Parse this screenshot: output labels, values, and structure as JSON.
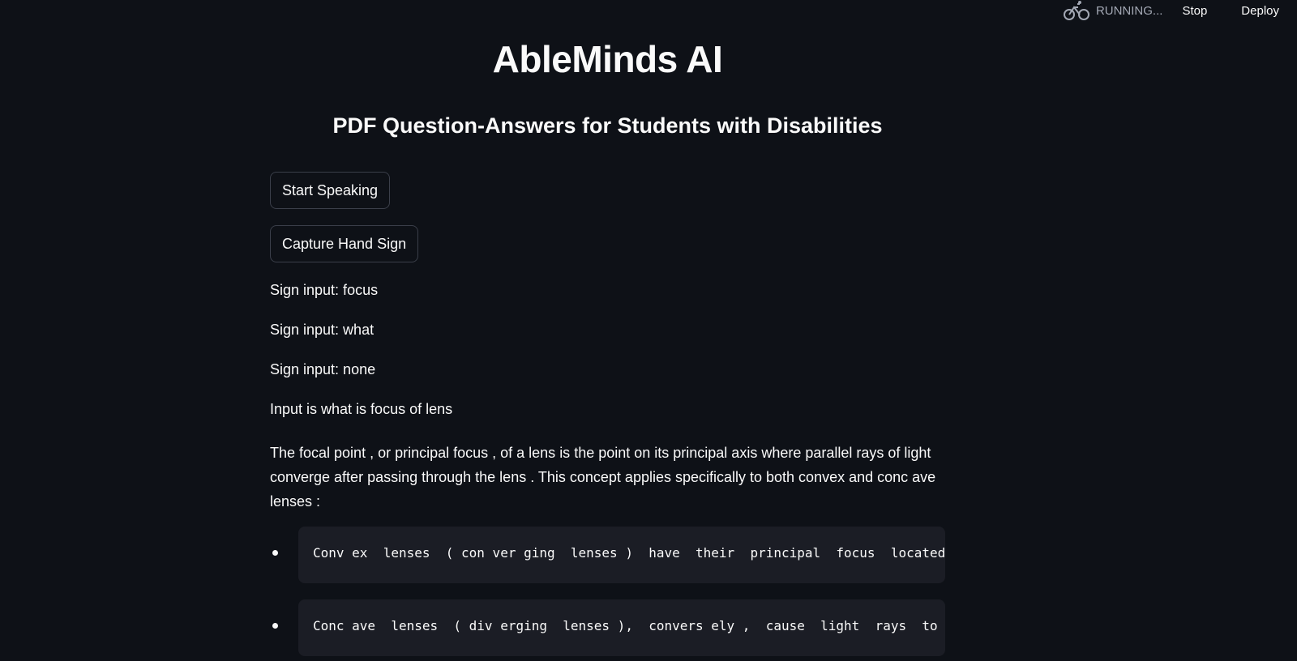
{
  "header": {
    "status_text": "RUNNING...",
    "status_icon": "bicycle-icon",
    "stop_label": "Stop",
    "deploy_label": "Deploy"
  },
  "page": {
    "title": "AbleMinds AI",
    "subtitle": "PDF Question-Answers for Students with Disabilities"
  },
  "buttons": {
    "start_speaking": "Start Speaking",
    "capture_hand_sign": "Capture Hand Sign"
  },
  "sign_inputs": [
    "Sign input: focus",
    "Sign input: what",
    "Sign input: none"
  ],
  "input_summary": "Input is what is focus of lens",
  "answer": {
    "paragraph": "The focal point , or principal focus , of a lens is the point on its principal axis where parallel rays of light converge after passing through the lens . This concept applies specifically to both convex and conc ave lenses :",
    "bullets": [
      "Conv ex  lenses  ( con ver ging  lenses )  have  their  principal  focus  located",
      "Conc ave  lenses  ( div erging  lenses ),  convers ely ,  cause  light  rays  to"
    ]
  },
  "colors": {
    "background": "#0e1117",
    "text": "#fafafa",
    "code_background": "#1b1d25",
    "button_border": "#3b3f4a",
    "status_text": "#a3a8b4"
  }
}
